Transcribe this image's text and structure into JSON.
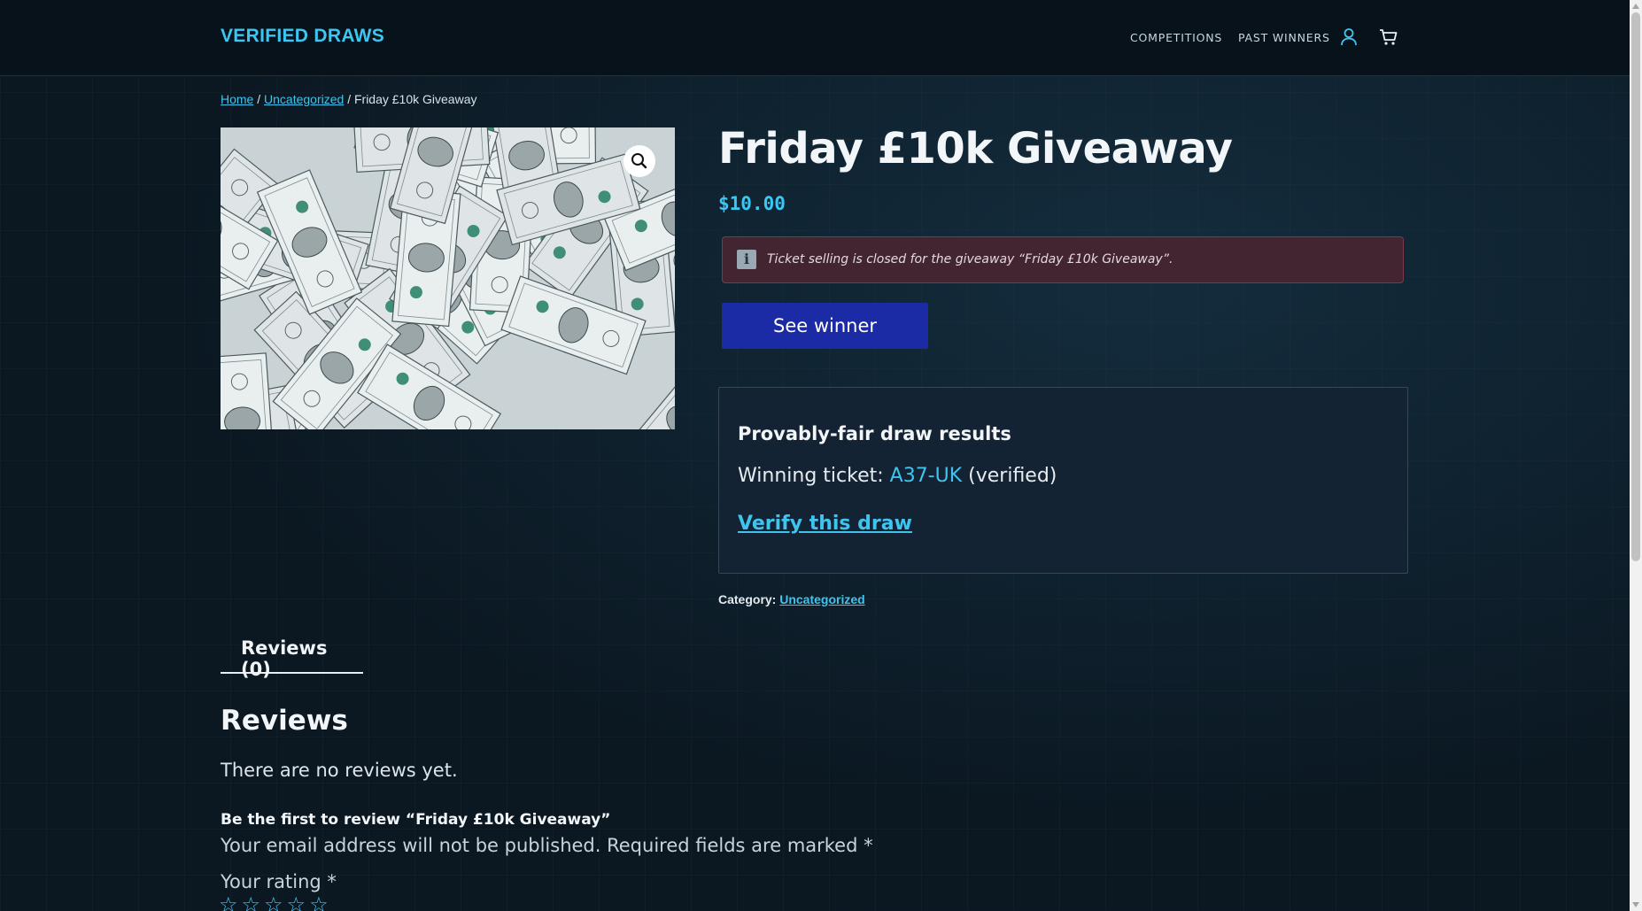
{
  "header": {
    "logo": "VERIFIED DRAWS",
    "nav": [
      {
        "label": "COMPETITIONS"
      },
      {
        "label": "PAST WINNERS"
      }
    ],
    "icons": [
      "user-icon",
      "cart-icon"
    ]
  },
  "breadcrumb": {
    "home": "Home",
    "sep1": " / ",
    "category": "Uncategorized",
    "sep2": " / ",
    "current": "Friday £10k Giveaway"
  },
  "product": {
    "title": "Friday £10k Giveaway",
    "price": "$10.00",
    "notice": "Ticket selling is closed for the giveaway “Friday £10k Giveaway”.",
    "notice_icon": "i",
    "see_winner_label": "See winner",
    "image_icon": "zoom-icon"
  },
  "draw": {
    "title": "Provably-fair draw results",
    "winning_prefix": "Winning ticket: ",
    "ticket": "A37-UK",
    "verified": " (verified)",
    "verify_link": "Verify this draw"
  },
  "meta": {
    "category_label": "Category: ",
    "category_value": "Uncategorized"
  },
  "tabs": [
    {
      "label": "Reviews (0)",
      "active": true
    }
  ],
  "reviews": {
    "heading": "Reviews",
    "empty": "There are no reviews yet.",
    "first_review": "Be the first to review “Friday £10k Giveaway”",
    "email_note": "Your email address will not be published. Required fields are marked *",
    "rating_label": "Your rating *",
    "stars": [
      "☆",
      "☆",
      "☆",
      "☆",
      "☆"
    ]
  },
  "colors": {
    "accent": "#3cc6f2",
    "button": "#1b2aa5",
    "notice_bg": "#432532",
    "background": "#0b1822"
  }
}
